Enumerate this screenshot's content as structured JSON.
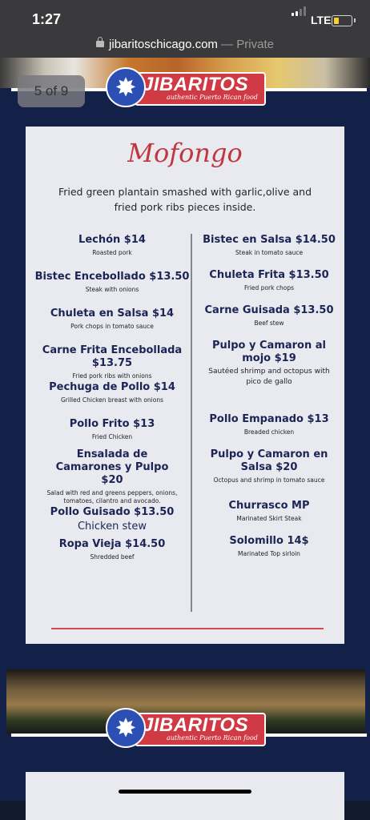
{
  "status_bar": {
    "time": "1:27",
    "network": "LTE"
  },
  "url_bar": {
    "domain": "jibaritoschicago.com",
    "mode": "— Private"
  },
  "pager": {
    "label": "5 of 9"
  },
  "logo": {
    "name": "JIBARITOS",
    "tagline": "authentic Puerto Rican food"
  },
  "menu": {
    "title": "Mofongo",
    "description": "Fried green plantain smashed with garlic,olive and fried pork ribs pieces inside.",
    "left": [
      {
        "name": "Lechón $14",
        "desc": "Roasted pork"
      },
      {
        "name": "Bistec Encebollado $13.50",
        "desc": "Steak with onions"
      },
      {
        "name": "Chuleta en Salsa  $14",
        "desc": "Pork chops in tomato sauce"
      },
      {
        "name": "Carne Frita Encebollada $13.75",
        "desc": "Fried pork ribs with onions"
      },
      {
        "name": "Pechuga de Pollo $14",
        "desc": "Grilled Chicken breast with onions"
      },
      {
        "name": "Pollo Frito $13",
        "desc": "Fried Chicken"
      },
      {
        "name": "Ensalada de Camarones y Pulpo $20",
        "desc": "Salad with red and greens peppers, onions, tomatoes, cilantro and avocado."
      },
      {
        "name": "Pollo Guisado $13.50",
        "desc": "Chicken stew"
      },
      {
        "name": "Ropa Vieja $14.50",
        "desc": "Shredded beef"
      }
    ],
    "right": [
      {
        "name": "Bistec en Salsa  $14.50",
        "desc": "Steak in tomato sauce"
      },
      {
        "name": "Chuleta Frita  $13.50",
        "desc": "Fried pork chops"
      },
      {
        "name": "Carne Guisada $13.50",
        "desc": "Beef stew"
      },
      {
        "name": "Pulpo y Camaron al mojo $19",
        "desc": "Sautéed shrimp and octopus with pico de gallo"
      },
      {
        "name": "Pollo Empanado  $13",
        "desc": "Breaded chicken"
      },
      {
        "name": "Pulpo y Camaron en Salsa $20",
        "desc": "Octopus and shrimp in tomato sauce"
      },
      {
        "name": "Churrasco MP",
        "desc": "Marinated Skirt Steak"
      },
      {
        "name": "Solomillo 14$",
        "desc": "Marinated Top sirloin"
      }
    ]
  },
  "colors": {
    "navy": "#132047",
    "card": "#e9eaf0",
    "red": "#c0373f",
    "blue": "#2c4fb3"
  }
}
